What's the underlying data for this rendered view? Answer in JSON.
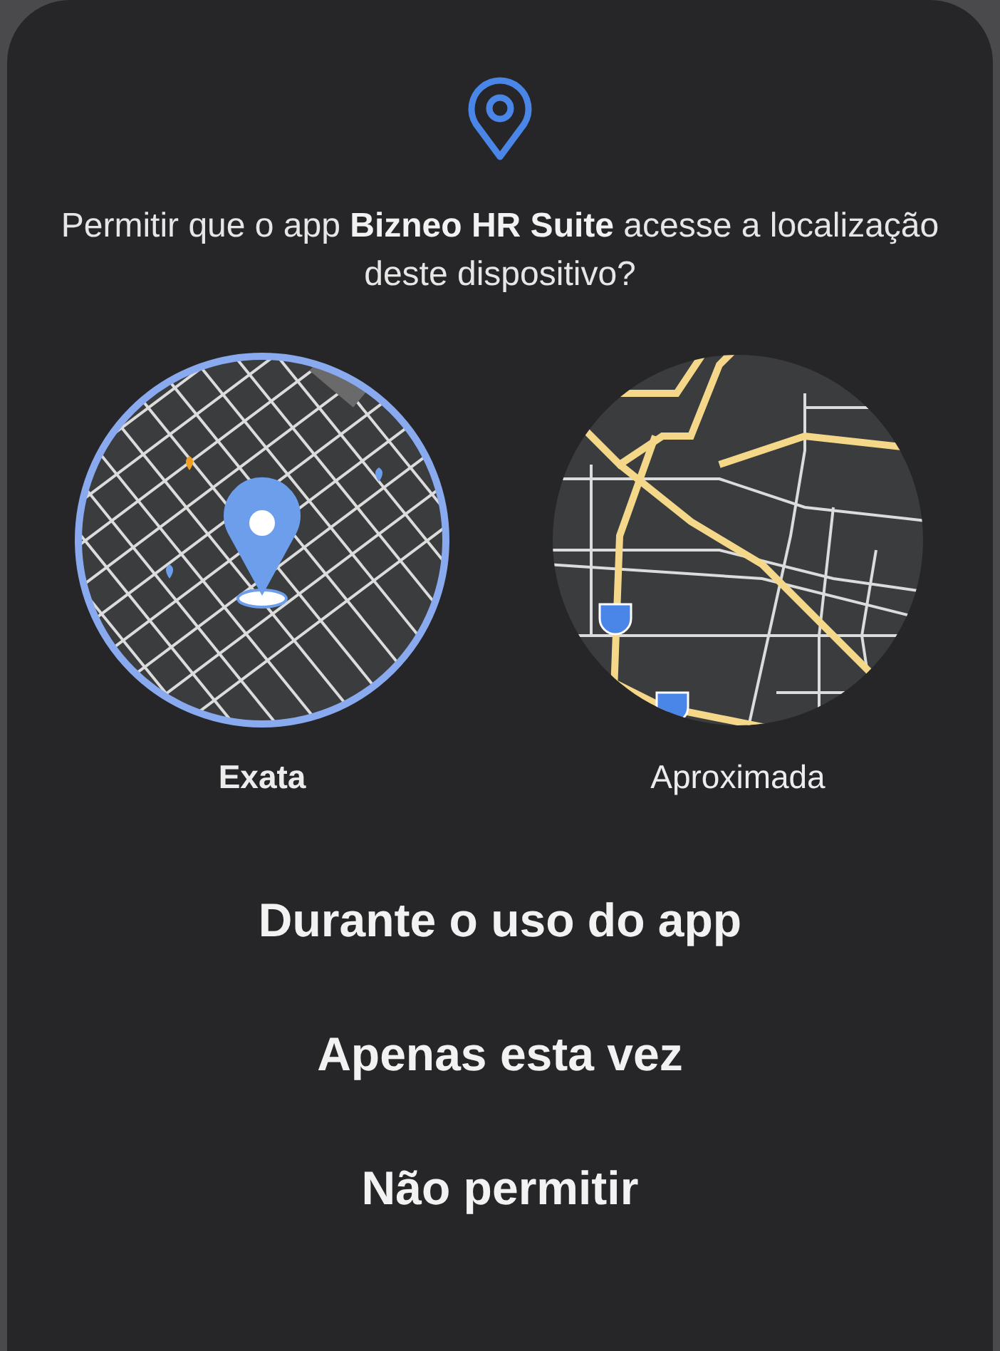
{
  "dialog": {
    "message": "Permitir que o app **Bizneo HR Suite** acesse a localização deste dispositivo?"
  },
  "accuracy_options": [
    {
      "kind": "precise",
      "label": "Exata",
      "selected": true
    },
    {
      "kind": "approximate",
      "label": "Aproximada",
      "selected": false
    }
  ],
  "buttons": [
    {
      "label": "Durante o uso do app"
    },
    {
      "label": "Apenas esta vez"
    },
    {
      "label": "Não permitir"
    }
  ]
}
